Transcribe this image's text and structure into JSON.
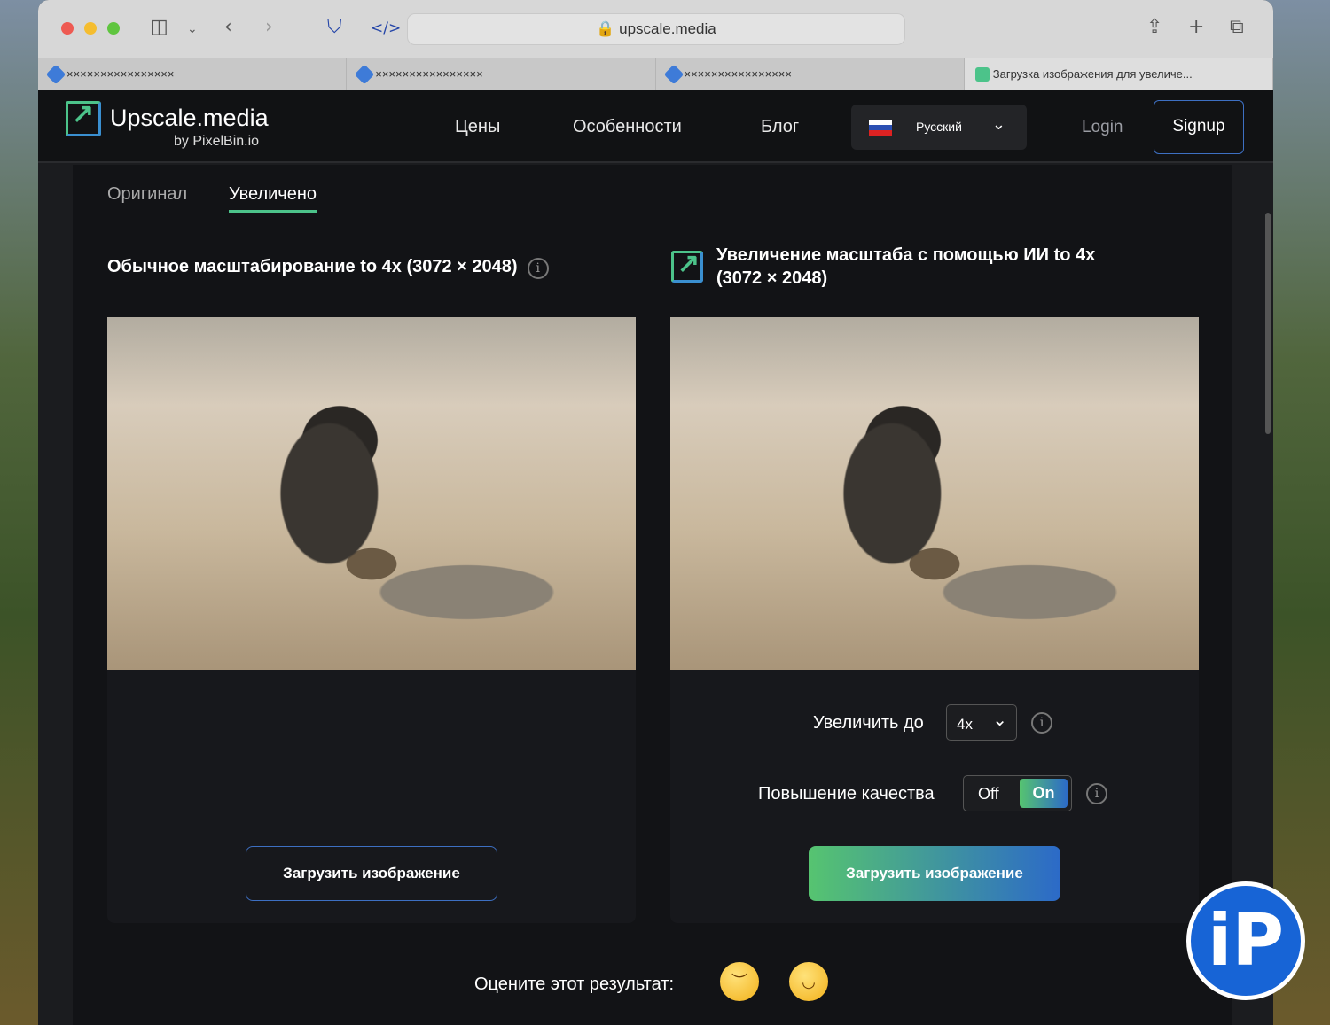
{
  "browser": {
    "url": "upscale.media",
    "tabs": [
      {
        "label": "××××××××××××××××"
      },
      {
        "label": "××××××××××××××××"
      },
      {
        "label": "××××××××××××××××"
      },
      {
        "label": "Загрузка изображения для увеличе..."
      }
    ]
  },
  "nav": {
    "brand": "Upscale.media",
    "by": "by PixelBin.io",
    "links": [
      "Цены",
      "Особенности",
      "Блог"
    ],
    "language": "Русский",
    "login": "Login",
    "signup": "Signup"
  },
  "view_tabs": [
    "Оригинал",
    "Увеличено"
  ],
  "left": {
    "title": "Обычное масштабирование to 4x (3072 × 2048)",
    "button": "Загрузить изображение"
  },
  "right": {
    "title": "Увеличение масштаба с помощью ИИ to 4x (3072 × 2048)",
    "scale_label": "Увеличить до",
    "scale_value": "4x",
    "quality_label": "Повышение качества",
    "off": "Off",
    "on": "On",
    "button": "Загрузить изображение"
  },
  "rating": {
    "label": "Оцените этот результат:"
  },
  "watermark": "iP",
  "colors": {
    "accent_green": "#56c470",
    "accent_blue": "#2c6ac8"
  }
}
